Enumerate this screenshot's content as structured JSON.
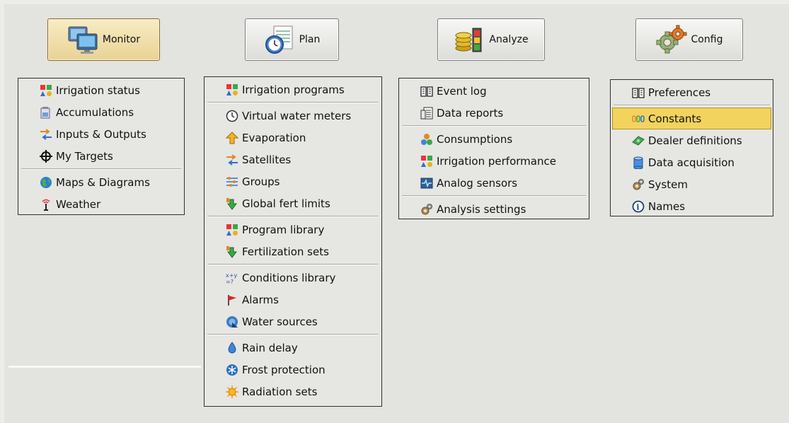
{
  "tabs": [
    {
      "key": "monitor",
      "label": "Monitor"
    },
    {
      "key": "plan",
      "label": "Plan"
    },
    {
      "key": "analyze",
      "label": "Analyze"
    },
    {
      "key": "config",
      "label": "Config"
    }
  ],
  "menus": {
    "monitor": [
      {
        "label": "Irrigation status",
        "icon": "irrigation-status-icon"
      },
      {
        "label": "Accumulations",
        "icon": "accumulations-icon"
      },
      {
        "label": "Inputs & Outputs",
        "icon": "inputs-outputs-icon"
      },
      {
        "label": "My Targets",
        "icon": "target-icon"
      },
      {
        "label": "Maps & Diagrams",
        "icon": "globe-icon"
      },
      {
        "label": "Weather",
        "icon": "antenna-icon"
      }
    ],
    "plan": [
      {
        "label": "Irrigation programs",
        "icon": "irrigation-programs-icon"
      },
      {
        "label": "Virtual water meters",
        "icon": "clock-icon"
      },
      {
        "label": "Evaporation",
        "icon": "arrow-up-icon"
      },
      {
        "label": "Satellites",
        "icon": "satellites-icon"
      },
      {
        "label": "Groups",
        "icon": "groups-icon"
      },
      {
        "label": "Global fert limits",
        "icon": "fertilizer-icon"
      },
      {
        "label": "Program library",
        "icon": "program-library-icon"
      },
      {
        "label": "Fertilization sets",
        "icon": "fertilizer-sets-icon"
      },
      {
        "label": "Conditions library",
        "icon": "formula-icon"
      },
      {
        "label": "Alarms",
        "icon": "flag-icon"
      },
      {
        "label": "Water sources",
        "icon": "water-source-icon"
      },
      {
        "label": "Rain delay",
        "icon": "water-drop-icon"
      },
      {
        "label": "Frost protection",
        "icon": "snowflake-icon"
      },
      {
        "label": "Radiation sets",
        "icon": "sun-icon"
      }
    ],
    "analyze": [
      {
        "label": "Event log",
        "icon": "book-icon"
      },
      {
        "label": "Data reports",
        "icon": "report-icon"
      },
      {
        "label": "Consumptions",
        "icon": "consumptions-icon"
      },
      {
        "label": "Irrigation performance",
        "icon": "performance-icon"
      },
      {
        "label": "Analog sensors",
        "icon": "sensor-icon"
      },
      {
        "label": "Analysis settings",
        "icon": "gears-icon"
      }
    ],
    "config": [
      {
        "label": "Preferences",
        "icon": "book-icon"
      },
      {
        "label": "Constants",
        "icon": "constants-icon"
      },
      {
        "label": "Dealer definitions",
        "icon": "dealer-icon"
      },
      {
        "label": "Data acquisition",
        "icon": "database-icon"
      },
      {
        "label": "System",
        "icon": "gears-icon"
      },
      {
        "label": "Names",
        "icon": "info-icon"
      }
    ]
  },
  "colors": {
    "selected_bg": "#f1d35e",
    "active_tab": "#f3e2a8"
  }
}
